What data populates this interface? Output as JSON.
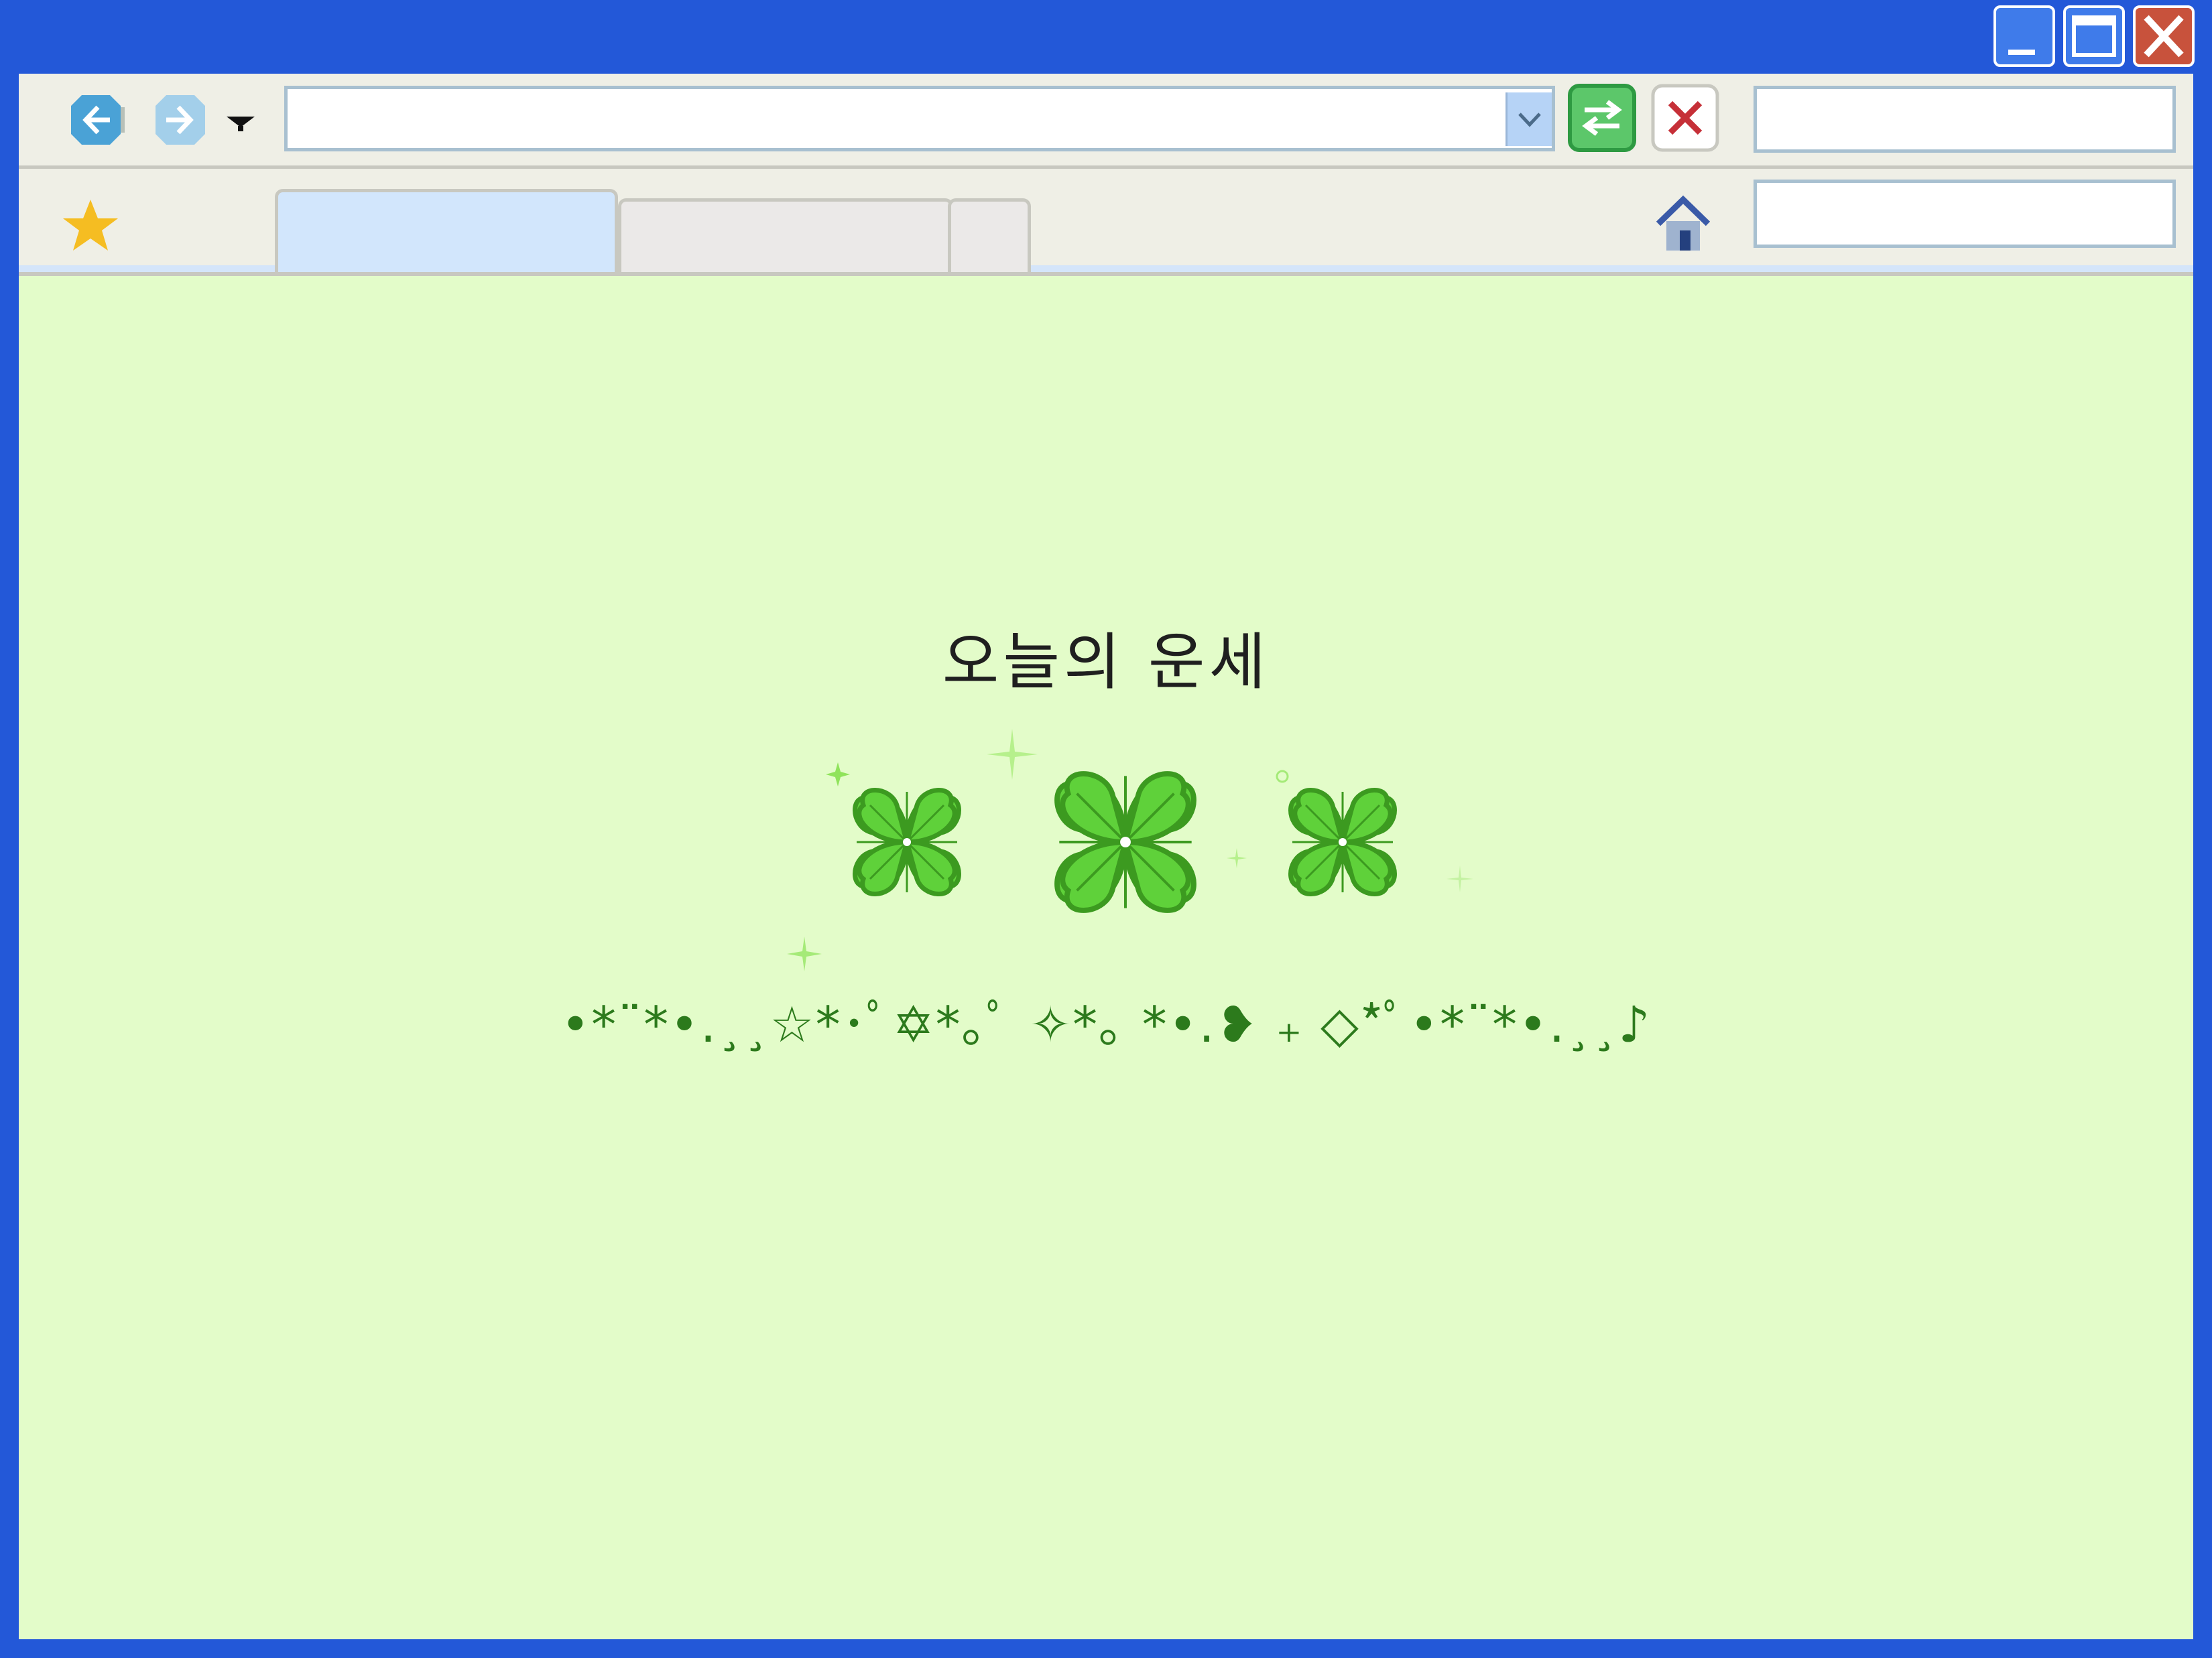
{
  "window": {
    "controls": [
      {
        "name": "minimize-button",
        "icon": "minimize-icon"
      },
      {
        "name": "maximize-button",
        "icon": "maximize-icon"
      },
      {
        "name": "close-window-button",
        "icon": "close-icon"
      }
    ],
    "frame_color": "#2358d8"
  },
  "toolbar": {
    "back_icon": "arrow-left-icon",
    "forward_icon": "arrow-right-icon",
    "history_dropdown_icon": "triangle-down-icon",
    "address_value": "",
    "go_icon": "refresh-icon",
    "stop_icon": "close-icon",
    "search_value": ""
  },
  "tabbar": {
    "bookmark_icon": "star-icon",
    "tabs": [
      {
        "label": "",
        "active": true
      },
      {
        "label": "",
        "active": false
      }
    ],
    "home_icon": "home-icon",
    "bookmark_search_value": ""
  },
  "page": {
    "title": "오늘의 운세",
    "decoration": "•*¨*•.¸¸☆*･ﾟ✡*｡ﾟ ✧*｡ *•.❥ ₊ ◇*ﾟ•*¨*•.¸¸♪",
    "background": "#e3fcc9",
    "clover_count": 3
  }
}
